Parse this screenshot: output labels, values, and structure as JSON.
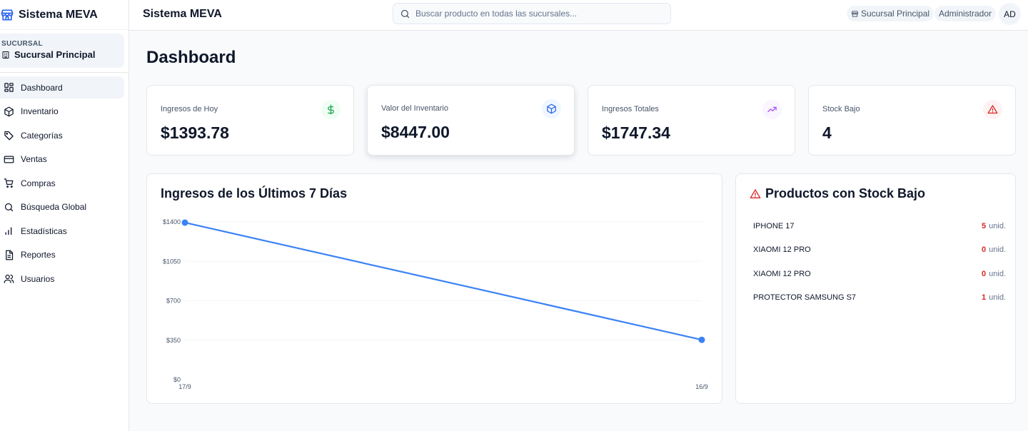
{
  "brand": {
    "title": "Sistema MEVA"
  },
  "branch": {
    "label": "SUCURSAL",
    "name": "Sucursal Principal"
  },
  "nav": [
    {
      "label": "Dashboard",
      "icon": "dashboard-icon",
      "active": true
    },
    {
      "label": "Inventario",
      "icon": "box-icon",
      "active": false
    },
    {
      "label": "Categorías",
      "icon": "tag-icon",
      "active": false
    },
    {
      "label": "Ventas",
      "icon": "credit-card-icon",
      "active": false
    },
    {
      "label": "Compras",
      "icon": "cart-icon",
      "active": false
    },
    {
      "label": "Búsqueda Global",
      "icon": "search-icon",
      "active": false
    },
    {
      "label": "Estadísticas",
      "icon": "bar-chart-icon",
      "active": false
    },
    {
      "label": "Reportes",
      "icon": "document-icon",
      "active": false
    },
    {
      "label": "Usuarios",
      "icon": "users-icon",
      "active": false
    }
  ],
  "header": {
    "title": "Sistema MEVA",
    "search_placeholder": "Buscar producto en todas las sucursales...",
    "search_value": "",
    "branch_chip": "Sucursal Principal",
    "role_chip": "Administrador",
    "avatar": "AD"
  },
  "page": {
    "title": "Dashboard"
  },
  "stats": [
    {
      "label": "Ingresos de Hoy",
      "value": "$1393.78",
      "icon": "dollar-icon",
      "color": "#16a34a",
      "bg": "#f0fdf4"
    },
    {
      "label": "Valor del Inventario",
      "value": "$8447.00",
      "icon": "package-icon",
      "color": "#2563eb",
      "bg": "#eff6ff"
    },
    {
      "label": "Ingresos Totales",
      "value": "$1747.34",
      "icon": "trending-up-icon",
      "color": "#a855f7",
      "bg": "#faf5ff"
    },
    {
      "label": "Stock Bajo",
      "value": "4",
      "icon": "alert-triangle-icon",
      "color": "#dc2626",
      "bg": "#fef2f2"
    }
  ],
  "chart_data": {
    "type": "line",
    "title": "Ingresos de los Últimos 7 Días",
    "x": [
      "17/9",
      "16/9"
    ],
    "series": [
      {
        "values": [
          1393.78,
          353.56
        ],
        "color": "#3b82f6"
      }
    ],
    "y_ticks": [
      "$0",
      "$350",
      "$700",
      "$1050",
      "$1400"
    ],
    "ylim": [
      0,
      1400
    ],
    "grid": true,
    "xlabel": "",
    "ylabel": ""
  },
  "low_stock": {
    "title": "Productos con Stock Bajo",
    "unit_label": "unid.",
    "items": [
      {
        "name": "IPHONE 17",
        "qty": "5"
      },
      {
        "name": "XIAOMI 12 PRO",
        "qty": "0"
      },
      {
        "name": "XIAOMI 12 PRO",
        "qty": "0"
      },
      {
        "name": "PROTECTOR SAMSUNG S7",
        "qty": "1"
      }
    ]
  }
}
